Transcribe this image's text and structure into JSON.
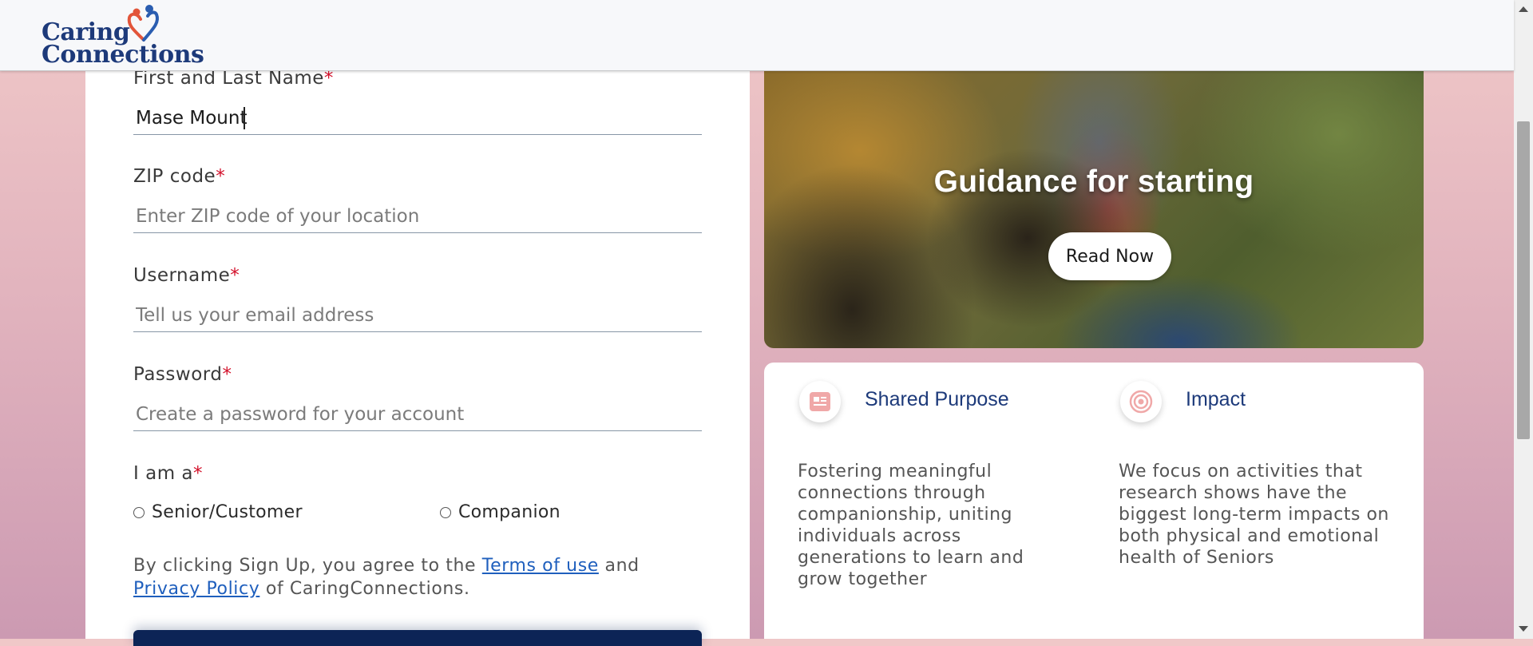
{
  "brand": {
    "line1": "Caring",
    "line2": "Connections"
  },
  "form": {
    "name": {
      "label": "First and Last Name",
      "required_mark": "*",
      "value": "Mase Mount"
    },
    "zip": {
      "label": "ZIP code",
      "required_mark": "*",
      "placeholder": "Enter ZIP code of your location"
    },
    "username": {
      "label": "Username",
      "required_mark": "*",
      "placeholder": "Tell us your email address"
    },
    "password": {
      "label": "Password",
      "required_mark": "*",
      "placeholder": "Create a password for your account"
    },
    "role": {
      "label": "I am a",
      "required_mark": "*",
      "options": [
        {
          "label": "Senior/Customer",
          "checked": false
        },
        {
          "label": "Companion",
          "checked": false
        }
      ]
    },
    "terms": {
      "prefix": "By clicking Sign Up, you agree to the ",
      "terms_link": "Terms of use",
      "middle": " and ",
      "privacy_link": "Privacy Policy",
      "suffix": " of CaringConnections."
    }
  },
  "hero": {
    "title": "Guidance for starting",
    "button": "Read Now"
  },
  "features": [
    {
      "icon": "news-card-icon",
      "title": "Shared Purpose",
      "text": "Fostering meaningful connections through companionship, uniting individuals across generations to learn and grow together"
    },
    {
      "icon": "target-icon",
      "title": "Impact",
      "text": "We focus on activities that research shows have the biggest long-term impacts on both physical and emotional health of Seniors"
    }
  ],
  "colors": {
    "brand_navy": "#1d3a7a",
    "required_red": "#d3102a",
    "link_blue": "#1f5fbd",
    "signup_navy": "#0c2456",
    "icon_pink": "#f0a8a8"
  }
}
